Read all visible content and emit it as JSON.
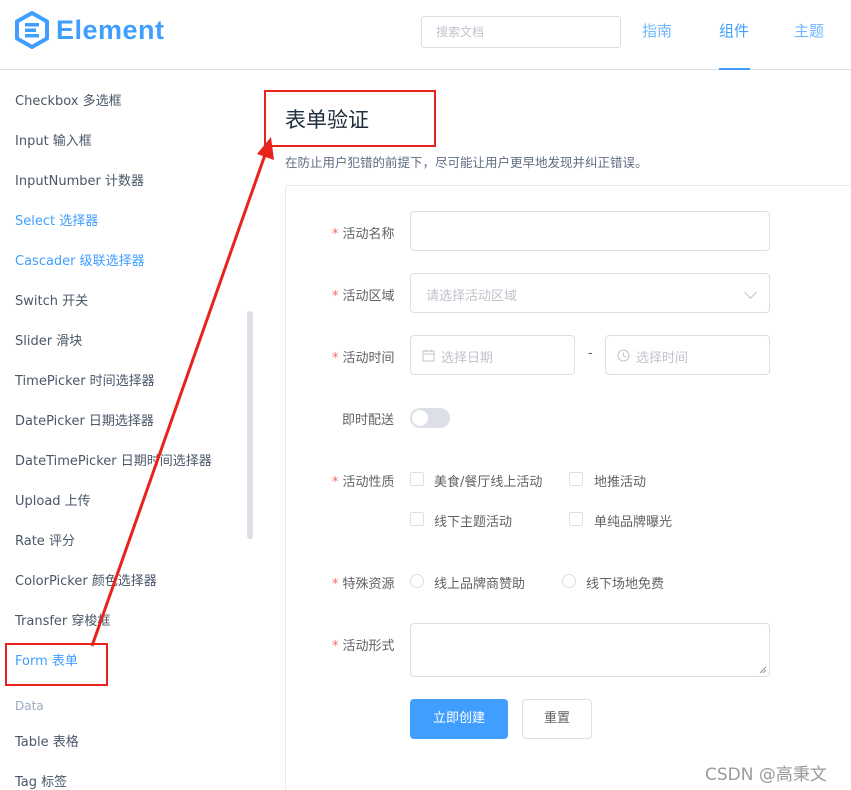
{
  "header": {
    "logo_text": "Element",
    "search_placeholder": "搜索文档",
    "nav": [
      {
        "label": "指南"
      },
      {
        "label": "组件"
      },
      {
        "label": "主题"
      }
    ]
  },
  "sidebar": {
    "items": [
      {
        "label": "Checkbox 多选框"
      },
      {
        "label": "Input 输入框"
      },
      {
        "label": "InputNumber 计数器"
      },
      {
        "label": "Select 选择器"
      },
      {
        "label": "Cascader 级联选择器"
      },
      {
        "label": "Switch 开关"
      },
      {
        "label": "Slider 滑块"
      },
      {
        "label": "TimePicker 时间选择器"
      },
      {
        "label": "DatePicker 日期选择器"
      },
      {
        "label": "DateTimePicker 日期时间选择器"
      },
      {
        "label": "Upload 上传"
      },
      {
        "label": "Rate 评分"
      },
      {
        "label": "ColorPicker 颜色选择器"
      },
      {
        "label": "Transfer 穿梭框"
      },
      {
        "label": "Form 表单"
      }
    ],
    "group_title": "Data",
    "items_data": [
      {
        "label": "Table 表格"
      },
      {
        "label": "Tag 标签"
      }
    ]
  },
  "main": {
    "title": "表单验证",
    "description": "在防止用户犯错的前提下，尽可能让用户更早地发现并纠正错误。",
    "form": {
      "required_mark": "*",
      "name_label": "活动名称",
      "region_label": "活动区域",
      "region_placeholder": "请选择活动区域",
      "time_label": "活动时间",
      "date_placeholder": "选择日期",
      "time_separator": "-",
      "time_placeholder": "选择时间",
      "delivery_label": "即时配送",
      "delivery_on": false,
      "type_label": "活动性质",
      "type_options": [
        "美食/餐厅线上活动",
        "地推活动",
        "线下主题活动",
        "单纯品牌曝光"
      ],
      "resource_label": "特殊资源",
      "resource_options": [
        "线上品牌商赞助",
        "线下场地免费"
      ],
      "desc_label": "活动形式",
      "submit_label": "立即创建",
      "reset_label": "重置"
    }
  },
  "watermark": "CSDN @高秉文",
  "colors": {
    "primary": "#409eff",
    "annotation": "#e8231c",
    "danger": "#f56c6c"
  }
}
